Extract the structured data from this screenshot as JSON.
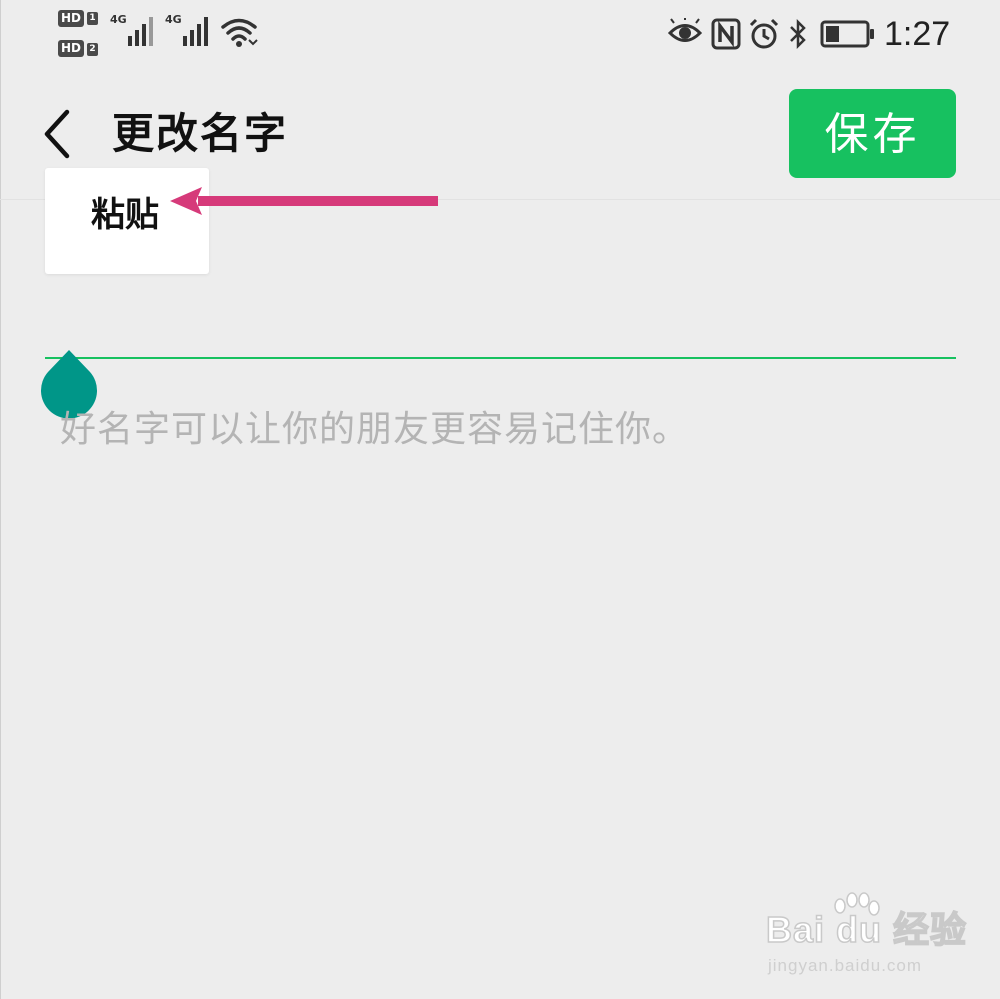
{
  "status_bar": {
    "sim1_badge": "HD",
    "sim1_index": "1",
    "sim2_badge": "HD",
    "sim2_index": "2",
    "network1": "4G",
    "network2": "4G",
    "time": "1:27",
    "battery_level": 0.35,
    "icons": [
      "eye-comfort-icon",
      "nfc-icon",
      "alarm-icon",
      "bluetooth-icon",
      "battery-icon",
      "wifi-icon",
      "signal-icon"
    ]
  },
  "nav": {
    "title": "更改名字",
    "save_label": "保存"
  },
  "popup": {
    "paste_label": "粘贴"
  },
  "input": {
    "hint": "好名字可以让你的朋友更容易记住你。"
  },
  "watermark": {
    "brand": "Bai du 经验",
    "url": "jingyan.baidu.com"
  },
  "colors": {
    "accent": "#17c160",
    "background": "#ededed",
    "cursor_handle": "#009688",
    "annotation_arrow": "#d63a7a",
    "hint_text": "#b4b4b4"
  }
}
